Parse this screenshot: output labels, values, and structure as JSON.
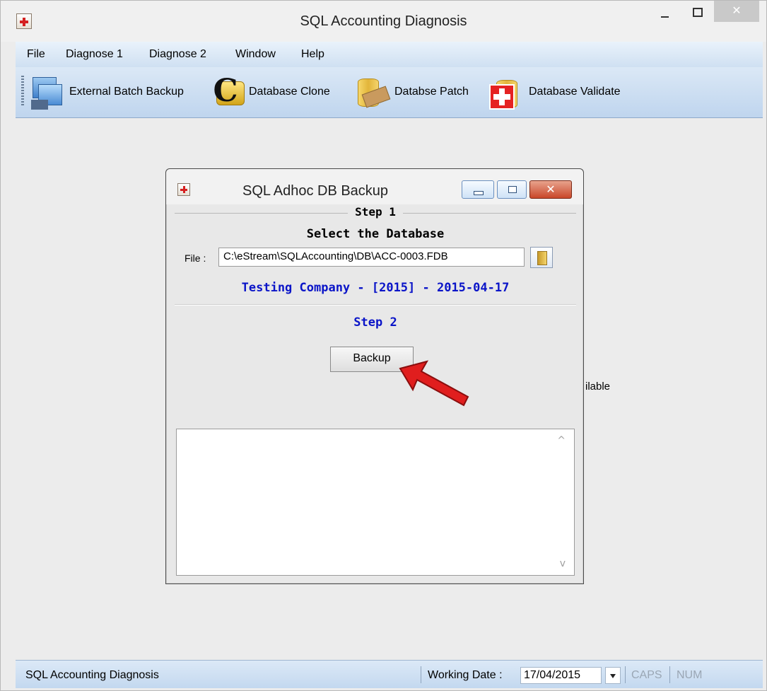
{
  "window": {
    "title": "SQL Accounting Diagnosis",
    "close_glyph": "✕"
  },
  "menu": [
    {
      "label": "File"
    },
    {
      "label": "Diagnose 1"
    },
    {
      "label": "Diagnose 2"
    },
    {
      "label": "Window"
    },
    {
      "label": "Help"
    }
  ],
  "toolbar": [
    {
      "label": "External Batch Backup",
      "icon": "backup-icon"
    },
    {
      "label": "Database Clone",
      "icon": "clone-icon"
    },
    {
      "label": "Databse Patch",
      "icon": "patch-icon"
    },
    {
      "label": "Database Validate",
      "icon": "validate-icon"
    }
  ],
  "background_text": "ilable",
  "dialog": {
    "title": "SQL Adhoc DB Backup",
    "close_glyph": "✕",
    "step1": "Step 1",
    "select_label": "Select the Database",
    "file_label": "File :",
    "file_value": "C:\\eStream\\SQLAccounting\\DB\\ACC-0003.FDB",
    "company": "Testing Company - [2015] - 2015-04-17",
    "step2": "Step 2",
    "backup_label": "Backup",
    "log_up": "^",
    "log_down": "v"
  },
  "statusbar": {
    "text": "SQL Accounting Diagnosis",
    "working_date_label": "Working Date :",
    "working_date_value": "17/04/2015",
    "caps": "CAPS",
    "num": "NUM"
  },
  "colors": {
    "accent_blue": "#0a14c8",
    "annotation_red": "#e01e1e"
  }
}
